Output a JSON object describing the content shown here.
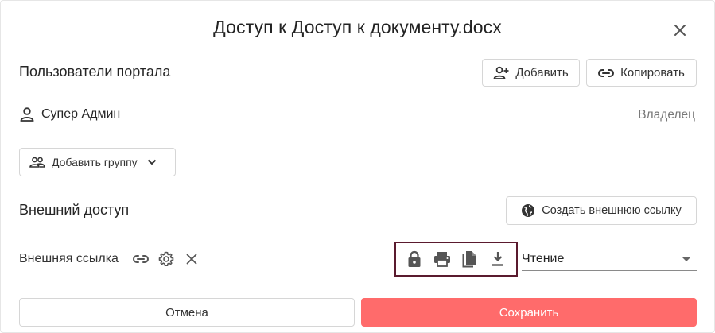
{
  "dialog": {
    "title": "Доступ к Доступ к документу.docx",
    "close_icon": "close-icon"
  },
  "portal": {
    "label": "Пользователи портала",
    "add_label": "Добавить",
    "copy_label": "Копировать",
    "user": {
      "name": "Супер Админ",
      "role": "Владелец",
      "icon": "person-icon"
    },
    "add_group_label": "Добавить группу"
  },
  "external": {
    "label": "Внешний доступ",
    "create_link_label": "Создать внешнюю ссылку",
    "link_label": "Внешняя ссылка",
    "permission_icons": [
      "lock-icon",
      "print-icon",
      "copy-document-icon",
      "download-icon"
    ],
    "access_level": "Чтение"
  },
  "footer": {
    "cancel_label": "Отмена",
    "save_label": "Сохранить"
  },
  "colors": {
    "save_bg": "#ff6b6b",
    "perm_border": "#5a1a2e",
    "icon": "#555555"
  }
}
